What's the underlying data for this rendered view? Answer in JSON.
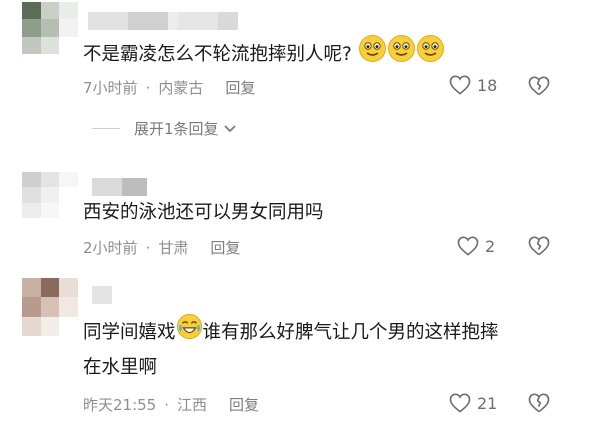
{
  "comments": [
    {
      "text": "不是霸凌怎么不轮流抱摔别人呢?",
      "emojis": [
        "smiley-emoji",
        "smiley-emoji",
        "smiley-emoji"
      ],
      "time": "7小时前",
      "location": "内蒙古",
      "reply_label": "回复",
      "likes": "18",
      "expand_label": "展开1条回复"
    },
    {
      "text": "西安的泳池还可以男女同用吗",
      "time": "2小时前",
      "location": "甘肃",
      "reply_label": "回复",
      "likes": "2"
    },
    {
      "text_part1": "同学间嬉戏",
      "text_part2": "谁有那么好脾气让几个男的这样抱摔",
      "text_line2": "在水里啊",
      "emoji": "laughing-tears-emoji",
      "time": "昨天21:55",
      "location": "江西",
      "reply_label": "回复",
      "likes": "21"
    }
  ],
  "colors": {
    "text": "#1a1a1a",
    "meta": "#8f8f8f",
    "icon": "#6e6e6e"
  }
}
